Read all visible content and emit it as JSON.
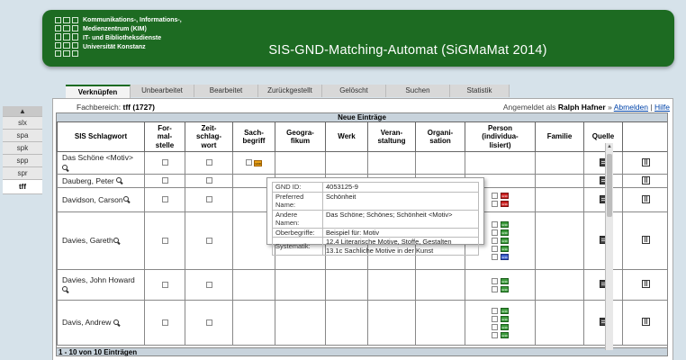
{
  "header": {
    "institution_lines": [
      "Kommunikations-, Informations-,",
      "Medienzentrum (KIM)",
      "IT- und Bibliotheksdienste",
      "Universität Konstanz"
    ],
    "title": "SIS-GND-Matching-Automat (SiGMaMat 2014)",
    "brand_color": "#1d6b22"
  },
  "tabs": [
    "Verknüpfen",
    "Unbearbeitet",
    "Bearbeitet",
    "Zurückgestellt",
    "Gelöscht",
    "Suchen",
    "Statistik"
  ],
  "active_tab": "Verknüpfen",
  "fachbereich": {
    "label": "Fachbereich:",
    "value": "tff (1727)"
  },
  "user": {
    "prefix": "Angemeldet als",
    "name": "Ralph Hafner",
    "arrow": "»",
    "logout": "Abmelden",
    "sep": "|",
    "help": "Hilfe"
  },
  "sidebar": {
    "items": [
      "slx",
      "spa",
      "spk",
      "spp",
      "spr",
      "tff"
    ],
    "active": "tff"
  },
  "table": {
    "caption": "Neue Einträge",
    "columns": [
      "SIS Schlagwort",
      "For-\nmal-\nstelle",
      "Zeit-\nschlag-\nwort",
      "Sach-\nbegriff",
      "Geogra-\nfikum",
      "Werk",
      "Veran-\nstaltung",
      "Organi-\nsation",
      "Person\n(individua-\nlisiert)",
      "Familie",
      "Quelle",
      ""
    ],
    "rows": [
      {
        "name": "Das Schöne <Motiv>"
      },
      {
        "name": "Dauberg, Peter"
      },
      {
        "name": "Davidson, Carson"
      },
      {
        "name": "Davies, Gareth"
      },
      {
        "name": "Davies, John Howard"
      },
      {
        "name": "Davis, Andrew"
      }
    ],
    "footer": "1 - 10 von 10 Einträgen"
  },
  "popup": {
    "gnd_id_label": "GND ID:",
    "gnd_id": "4053125-9",
    "pref_label": "Preferred Name:",
    "pref": "Schönheit",
    "other_label": "Andere Namen:",
    "other": "Das Schöne; Schönes; Schönheit <Motiv>",
    "ober_label": "Oberbegriffe:",
    "ober": "Beispiel für: Motiv",
    "sys_label": "Systematik:",
    "sys1": "12.4 Literarische Motive, Stoffe, Gestalten",
    "sys2": "13.1c Sachliche Motive in der Kunst"
  },
  "icons": {
    "gnd_badge": "GND",
    "gnd_colors": {
      "orange": "#e8a017",
      "green": "#3a9a3a",
      "red": "#cc2222",
      "blue": "#3a5fcc"
    }
  }
}
